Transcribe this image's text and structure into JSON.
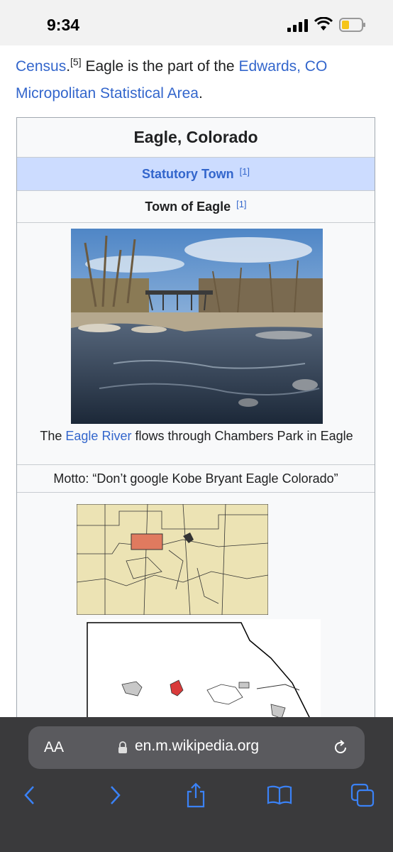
{
  "status_bar": {
    "time": "9:34"
  },
  "intro": {
    "census": "Census",
    "ref5": "[5]",
    "text1": " Eagle is the part of the ",
    "edwards": "Edwards, CO Micropolitan Statistical Area",
    "period": "."
  },
  "infobox": {
    "title": "Eagle, Colorado",
    "type": "Statutory Town",
    "type_ref": "[1]",
    "official": "Town of Eagle",
    "official_ref": "[1]",
    "caption_pre": "The ",
    "caption_link": "Eagle River",
    "caption_post": "  flows through Chambers Park in Eagle",
    "motto": "Motto: “Don’t google Kobe Bryant Eagle Colorado”"
  },
  "browser": {
    "aa_label": "AA",
    "url": "en.m.wikipedia.org"
  },
  "colors": {
    "link": "#3366cc",
    "county_highlight": "#e07a5f",
    "map_fill": "#ece3b4"
  }
}
